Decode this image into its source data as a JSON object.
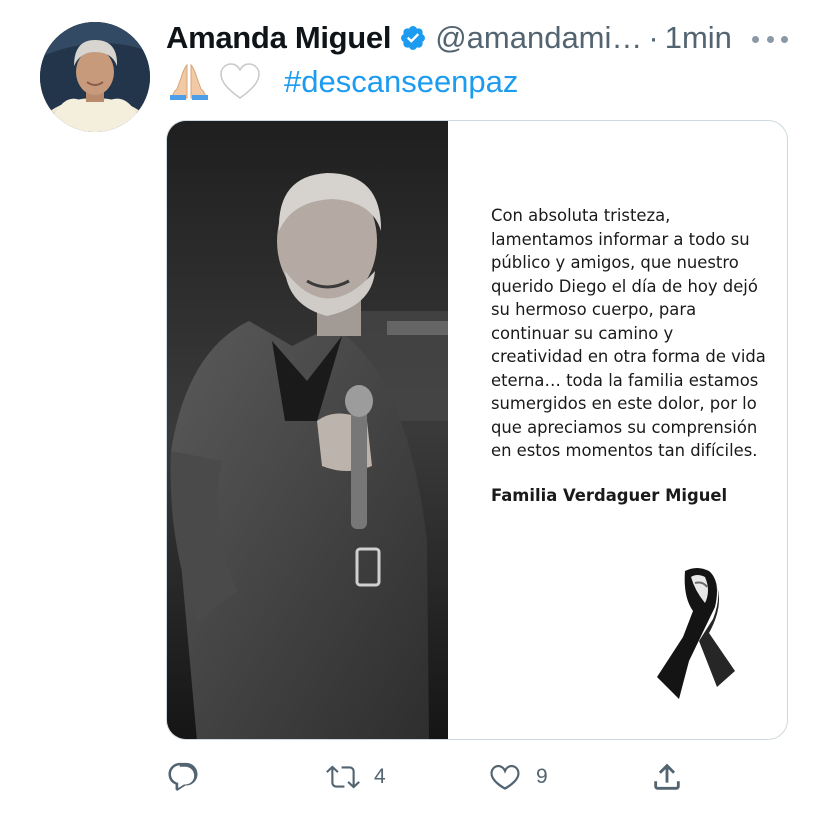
{
  "author": {
    "name": "Amanda Miguel",
    "handle": "@amandami…",
    "separator": "·",
    "time": "1min",
    "verified": true
  },
  "tweet": {
    "emojis": [
      "folded-hands",
      "white-heart"
    ],
    "hashtag": "#descanseenpaz"
  },
  "media": {
    "message_lines": [
      "Con absoluta tristeza,",
      "lamentamos informar a todo su",
      "público y amigos, que nuestro",
      "querido Diego el día de hoy dejó",
      "su hermoso cuerpo, para",
      "continuar su camino y",
      "creatividad en otra forma de vida",
      "eterna… toda la familia estamos",
      "sumergidos en este dolor, por lo",
      "que apreciamos su comprensión",
      "en estos momentos tan difíciles."
    ],
    "signature": "Familia Verdaguer Miguel"
  },
  "actions": {
    "reply_count": "",
    "retweet_count": "4",
    "like_count": "9"
  },
  "colors": {
    "accent": "#1d9bf0",
    "secondary_text": "#536471",
    "border": "#cfd9de"
  },
  "icons": {
    "more": "more-dots-icon",
    "reply": "reply-icon",
    "retweet": "retweet-icon",
    "like": "heart-icon",
    "share": "share-icon",
    "verified": "verified-badge-icon"
  }
}
